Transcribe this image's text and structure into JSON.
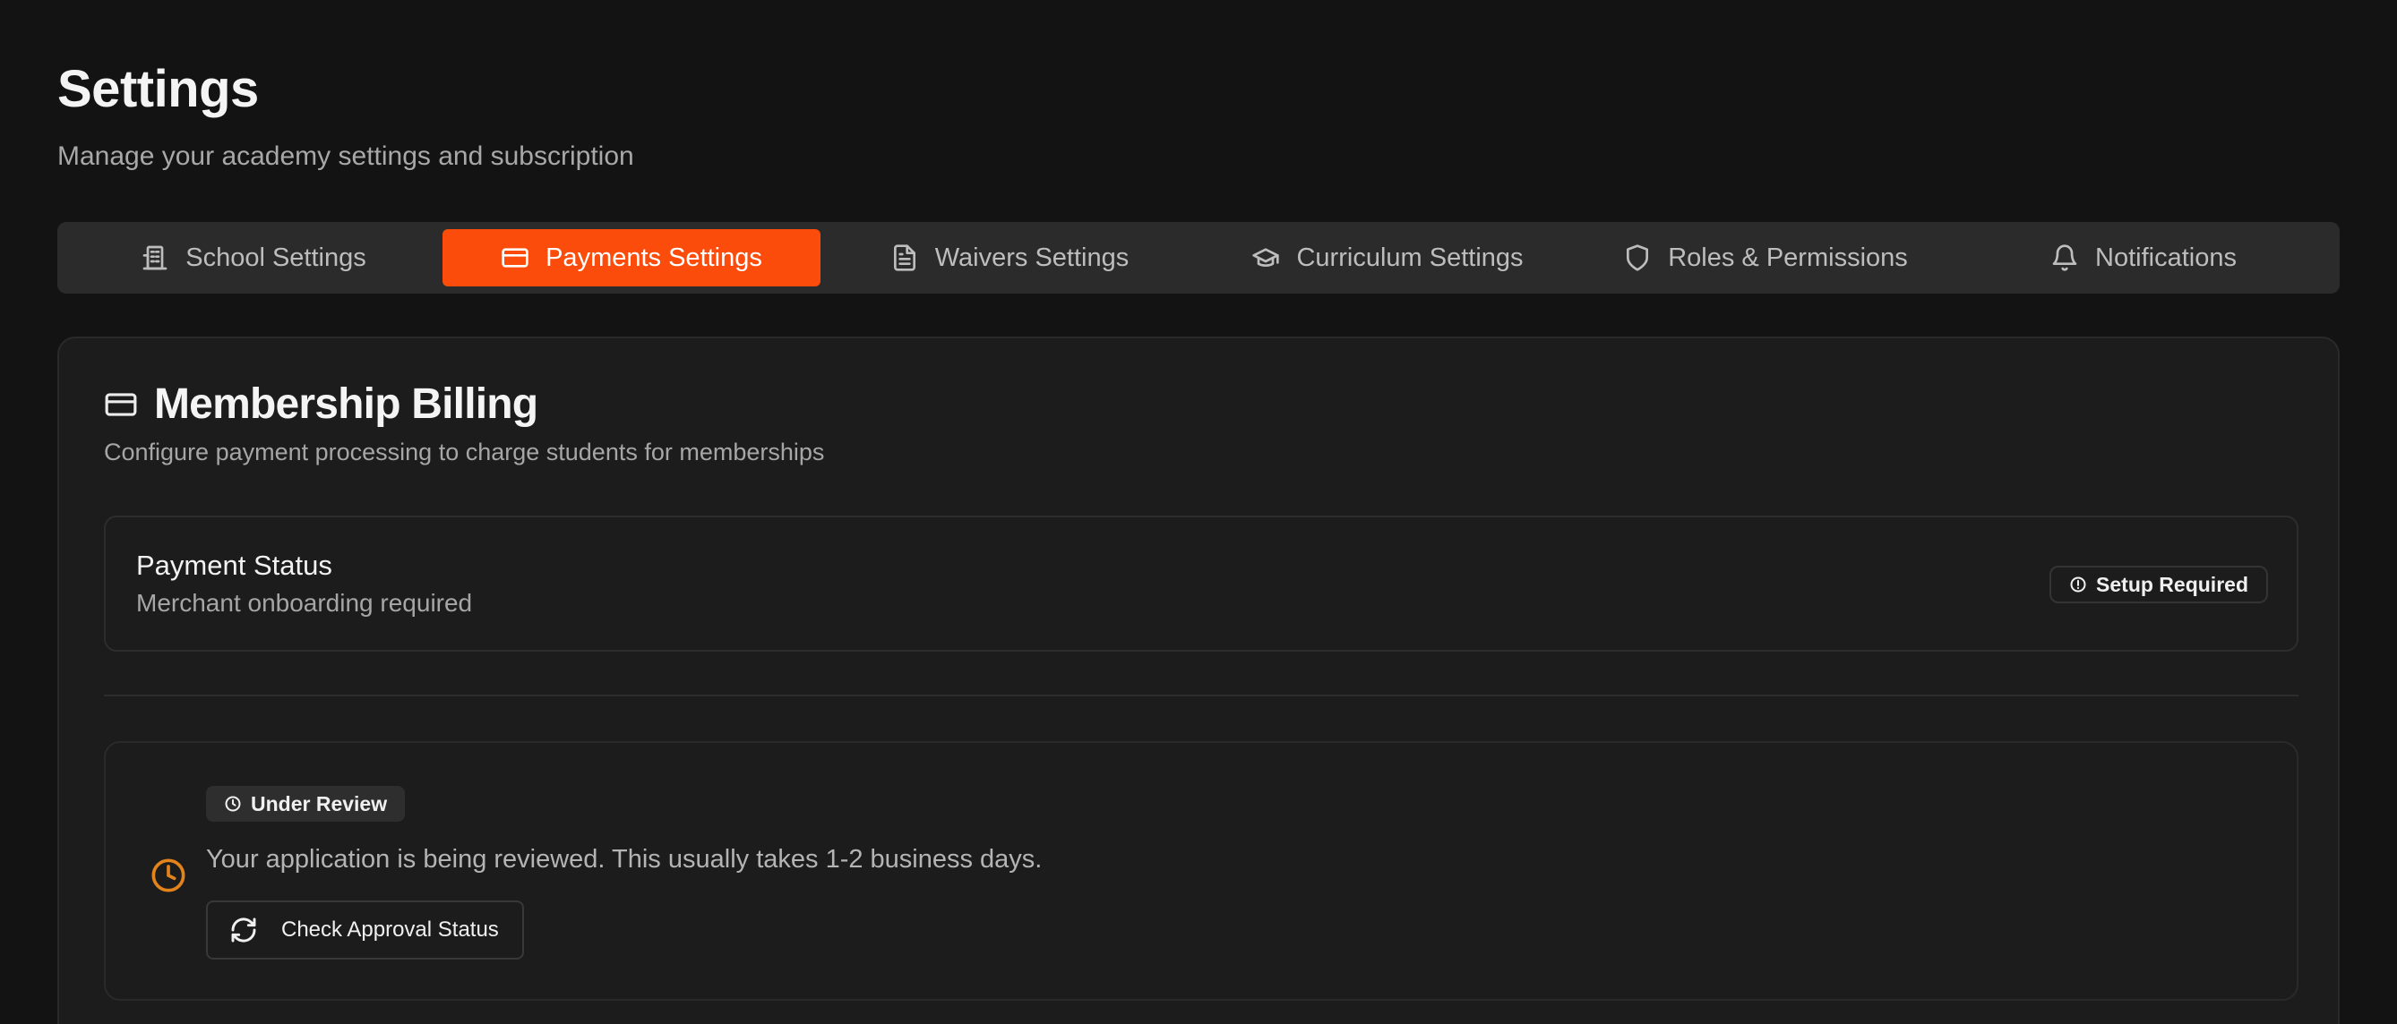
{
  "header": {
    "title": "Settings",
    "subtitle": "Manage your academy settings and subscription"
  },
  "tabs": [
    {
      "label": "School Settings",
      "icon": "building-icon",
      "active": false
    },
    {
      "label": "Payments Settings",
      "icon": "credit-card-icon",
      "active": true
    },
    {
      "label": "Waivers Settings",
      "icon": "document-icon",
      "active": false
    },
    {
      "label": "Curriculum Settings",
      "icon": "graduation-cap-icon",
      "active": false
    },
    {
      "label": "Roles & Permissions",
      "icon": "shield-icon",
      "active": false
    },
    {
      "label": "Notifications",
      "icon": "bell-icon",
      "active": false
    }
  ],
  "billing": {
    "title": "Membership Billing",
    "description": "Configure payment processing to charge students for memberships",
    "status": {
      "title": "Payment Status",
      "subtitle": "Merchant onboarding required",
      "badge": "Setup Required"
    },
    "review": {
      "badge": "Under Review",
      "message": "Your application is being reviewed. This usually takes 1-2 business days.",
      "button_label": "Check Approval Status"
    }
  },
  "colors": {
    "background": "#131313",
    "accent": "#fb4c0b",
    "pending": "#e2831c"
  }
}
